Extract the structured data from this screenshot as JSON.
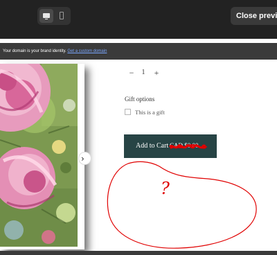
{
  "toolbar": {
    "devices": [
      {
        "name": "desktop-icon",
        "active": true
      },
      {
        "name": "mobile-icon",
        "active": false
      }
    ],
    "close_label": "Close preview"
  },
  "banner": {
    "text": "Your domain is your brand identity.",
    "link": "Get a custom domain"
  },
  "product": {
    "quantity": "1",
    "qty_minus": "−",
    "qty_plus": "+",
    "gift_title": "Gift options",
    "gift_label": "This is a gift",
    "add_to_cart": "Add to Cart",
    "price": "CAD $0.00"
  },
  "carousel": {
    "next_icon": "›"
  },
  "annotation": {
    "mark": "?"
  },
  "colors": {
    "topbar": "#222222",
    "banner": "#3b3b3b",
    "button": "#274445",
    "annotation": "#e00000",
    "link": "#7aa7ff"
  }
}
